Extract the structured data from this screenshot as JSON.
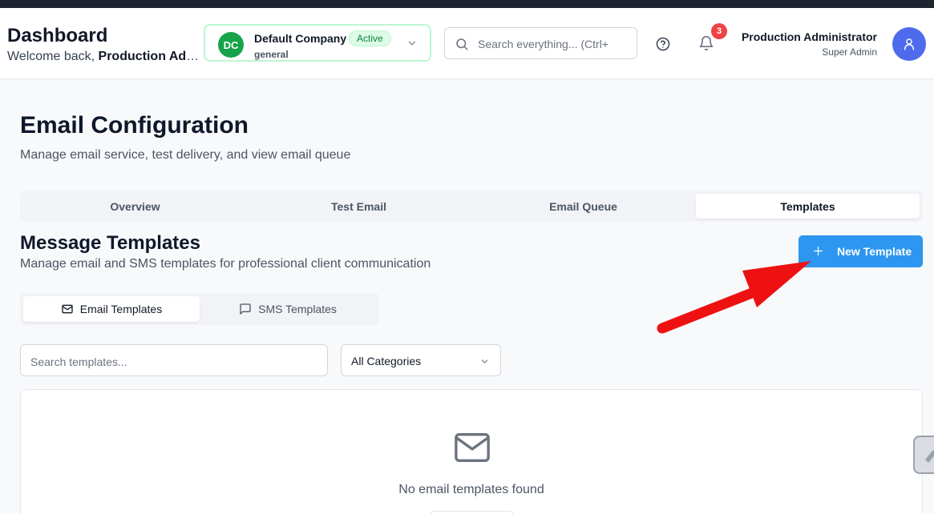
{
  "header": {
    "title": "Dashboard",
    "welcome_prefix": "Welcome back, ",
    "welcome_name": "Production Adm...",
    "company": {
      "initials": "DC",
      "name": "Default Company",
      "status": "Active",
      "type": "general"
    },
    "search_placeholder": "Search everything... (Ctrl+",
    "notification_count": "3",
    "user": {
      "name": "Production Administrator",
      "role": "Super Admin"
    }
  },
  "page": {
    "title": "Email Configuration",
    "subtitle": "Manage email service, test delivery, and view email queue"
  },
  "tabs": [
    {
      "label": "Overview",
      "active": false
    },
    {
      "label": "Test Email",
      "active": false
    },
    {
      "label": "Email Queue",
      "active": false
    },
    {
      "label": "Templates",
      "active": true
    }
  ],
  "templates": {
    "title": "Message Templates",
    "subtitle": "Manage email and SMS templates for professional client communication",
    "new_button": "New Template",
    "subtabs": [
      {
        "label": "Email Templates",
        "icon": "mail-icon",
        "active": true
      },
      {
        "label": "SMS Templates",
        "icon": "message-icon",
        "active": false
      }
    ],
    "search_placeholder": "Search templates...",
    "category_selected": "All Categories",
    "empty_message": "No email templates found"
  },
  "colors": {
    "primary": "#2d96f0",
    "active_badge": "#dcfce7",
    "company_avatar": "#16a34a",
    "user_avatar": "#4f6bed",
    "notification": "#ef4444",
    "annotation_arrow": "#ee1111"
  }
}
